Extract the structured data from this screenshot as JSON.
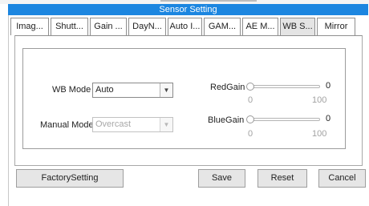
{
  "window": {
    "title": "Sensor Setting"
  },
  "tabs": [
    {
      "label": "Imag..."
    },
    {
      "label": "Shutt..."
    },
    {
      "label": "Gain ..."
    },
    {
      "label": "DayN..."
    },
    {
      "label": "Auto I..."
    },
    {
      "label": "GAM..."
    },
    {
      "label": "AE M..."
    },
    {
      "label": "WB S...",
      "active": true
    },
    {
      "label": "Mirror"
    }
  ],
  "wb": {
    "mode_label": "WB Mode",
    "mode_value": "Auto",
    "manual_label": "Manual Mode",
    "manual_value": "Overcast",
    "manual_disabled": true,
    "red": {
      "label": "RedGain",
      "value": "0",
      "min": "0",
      "max": "100"
    },
    "blue": {
      "label": "BlueGain",
      "value": "0",
      "min": "0",
      "max": "100"
    }
  },
  "footer": {
    "factory_label": "FactorySetting",
    "save_label": "Save",
    "reset_label": "Reset",
    "cancel_label": "Cancel"
  },
  "icons": {
    "dropdown_arrow": "chevron-down-icon"
  },
  "colors": {
    "titlebar": "#1c86e0",
    "active_tab": "#e4e4e4",
    "button": "#e6e6e6"
  }
}
